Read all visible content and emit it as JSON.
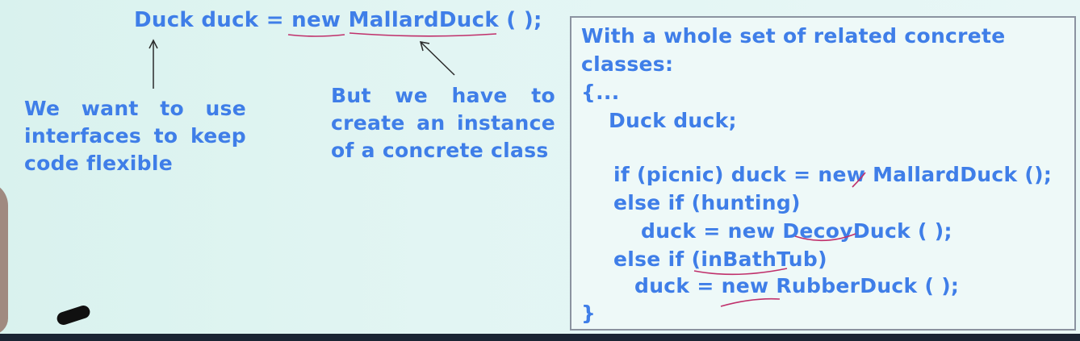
{
  "top": {
    "code_prefix": "Duck duck = ",
    "new_kw": "new",
    "class_name": "MallardDuck",
    "code_suffix": " ( );"
  },
  "notes": {
    "interfaces": "We want to use interfaces to keep code flexible",
    "instance": "But we have to create an instance of a concrete class"
  },
  "panel": {
    "heading_line1": "With a whole set of related concrete",
    "heading_line2": "classes:",
    "lines": [
      "{...",
      "Duck duck;",
      "if (picnic) duck = new MallardDuck ();",
      "else if (hunting)",
      "duck = new DecoyDuck ( );",
      "else if (inBathTub)",
      "duck = new RubberDuck ( );",
      "}"
    ]
  },
  "colors": {
    "text": "#3f7ee8",
    "annotation": "#c0306b",
    "background": "#dff4f1"
  }
}
